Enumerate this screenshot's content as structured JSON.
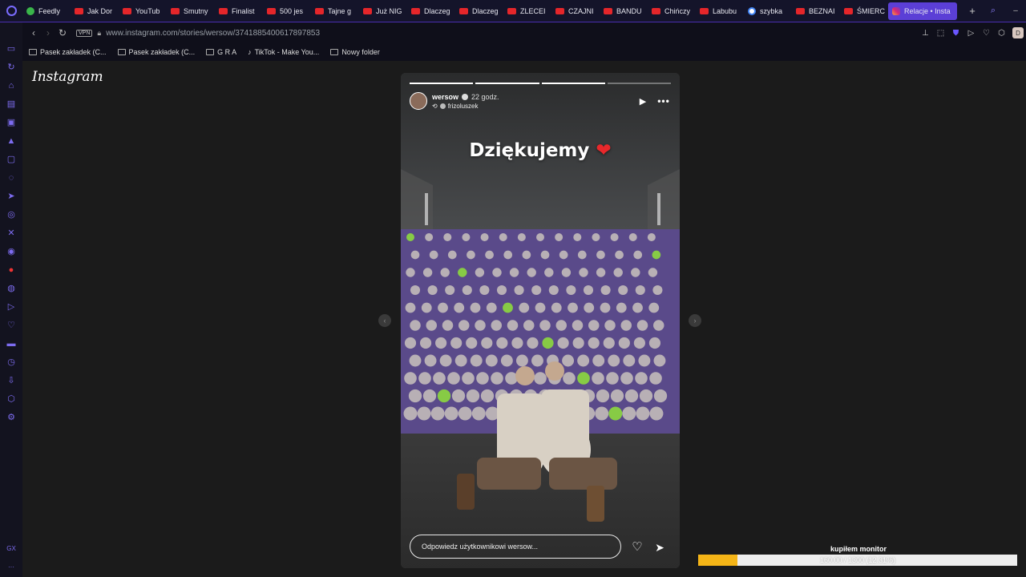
{
  "tabs": [
    {
      "label": "Feedly",
      "icon": "feedly-icon"
    },
    {
      "label": "Jak Dor",
      "icon": "youtube-icon"
    },
    {
      "label": "YouTub",
      "icon": "youtube-icon"
    },
    {
      "label": "Smutny",
      "icon": "youtube-icon"
    },
    {
      "label": "Finalist",
      "icon": "youtube-icon"
    },
    {
      "label": "500 jes",
      "icon": "youtube-icon"
    },
    {
      "label": "Tajne g",
      "icon": "youtube-icon"
    },
    {
      "label": "Już NIG",
      "icon": "youtube-icon"
    },
    {
      "label": "Dlaczeg",
      "icon": "youtube-icon"
    },
    {
      "label": "Dlaczeg",
      "icon": "youtube-icon"
    },
    {
      "label": "ZLECEI",
      "icon": "youtube-icon"
    },
    {
      "label": "CZAJNI",
      "icon": "youtube-icon"
    },
    {
      "label": "BANDU",
      "icon": "youtube-icon"
    },
    {
      "label": "Chińczy",
      "icon": "youtube-icon"
    },
    {
      "label": "Labubu",
      "icon": "youtube-icon"
    },
    {
      "label": "szybka",
      "icon": "google-icon"
    },
    {
      "label": "BEZNAI",
      "icon": "youtube-icon"
    },
    {
      "label": "ŚMIERC",
      "icon": "youtube-icon"
    },
    {
      "label": "Relacje • Insta",
      "icon": "instagram-icon",
      "active": true
    }
  ],
  "address_bar": {
    "vpn": "VPN",
    "url": "www.instagram.com/stories/wersow/3741885400617897853"
  },
  "bookmarks": [
    "Pasek zakładek (C...",
    "Pasek zakładek (C...",
    "G R A",
    "TikTok - Make You...",
    "Nowy folder"
  ],
  "profile_initial": "D",
  "instagram": {
    "logo": "Instagram",
    "story": {
      "username": "wersow",
      "time": "22 godz.",
      "reposted_from": "frizoluszek",
      "caption": "Dziękujemy",
      "caption_emoji": "❤",
      "reply_placeholder": "Odpowiedz użytkownikowi wersow...",
      "progress_segments": 4,
      "completed_segments": 3
    }
  },
  "overlay": {
    "title": "kupiłem monitor",
    "progress_text": "160.00 / 1300 (12.31%)",
    "progress_fraction": 0.1231,
    "fill_color": "#f5b517"
  },
  "colors": {
    "accent": "#5b3fd6",
    "youtube": "#e5262a"
  }
}
